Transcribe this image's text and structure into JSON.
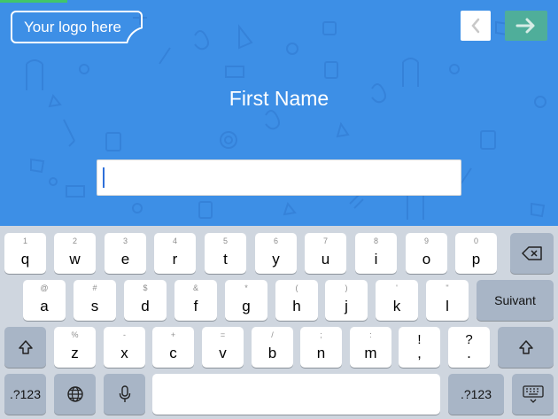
{
  "header": {
    "logo_text": "Your logo here"
  },
  "form": {
    "label": "First Name",
    "input_value": ""
  },
  "keyboard": {
    "row1": [
      {
        "hint": "1",
        "key": "q"
      },
      {
        "hint": "2",
        "key": "w"
      },
      {
        "hint": "3",
        "key": "e"
      },
      {
        "hint": "4",
        "key": "r"
      },
      {
        "hint": "5",
        "key": "t"
      },
      {
        "hint": "6",
        "key": "y"
      },
      {
        "hint": "7",
        "key": "u"
      },
      {
        "hint": "8",
        "key": "i"
      },
      {
        "hint": "9",
        "key": "o"
      },
      {
        "hint": "0",
        "key": "p"
      }
    ],
    "row2": [
      {
        "hint": "@",
        "key": "a"
      },
      {
        "hint": "#",
        "key": "s"
      },
      {
        "hint": "$",
        "key": "d"
      },
      {
        "hint": "&",
        "key": "f"
      },
      {
        "hint": "*",
        "key": "g"
      },
      {
        "hint": "(",
        "key": "h"
      },
      {
        "hint": ")",
        "key": "j"
      },
      {
        "hint": "'",
        "key": "k"
      },
      {
        "hint": "\"",
        "key": "l"
      }
    ],
    "row3": [
      {
        "hint": "%",
        "key": "z"
      },
      {
        "hint": "-",
        "key": "x"
      },
      {
        "hint": "+",
        "key": "c"
      },
      {
        "hint": "=",
        "key": "v"
      },
      {
        "hint": "/",
        "key": "b"
      },
      {
        "hint": ";",
        "key": "n"
      },
      {
        "hint": ":",
        "key": "m"
      },
      {
        "hint": "!",
        "key": ","
      },
      {
        "hint": "?",
        "key": "."
      }
    ],
    "return_label": "Suivant",
    "numbers_label": ".?123",
    "numbers_label_right": ".?123"
  },
  "colors": {
    "background": "#3d8fe6",
    "next_button": "#4fae9a",
    "keyboard": "#cfd6df",
    "function_key": "#a8b5c6"
  }
}
